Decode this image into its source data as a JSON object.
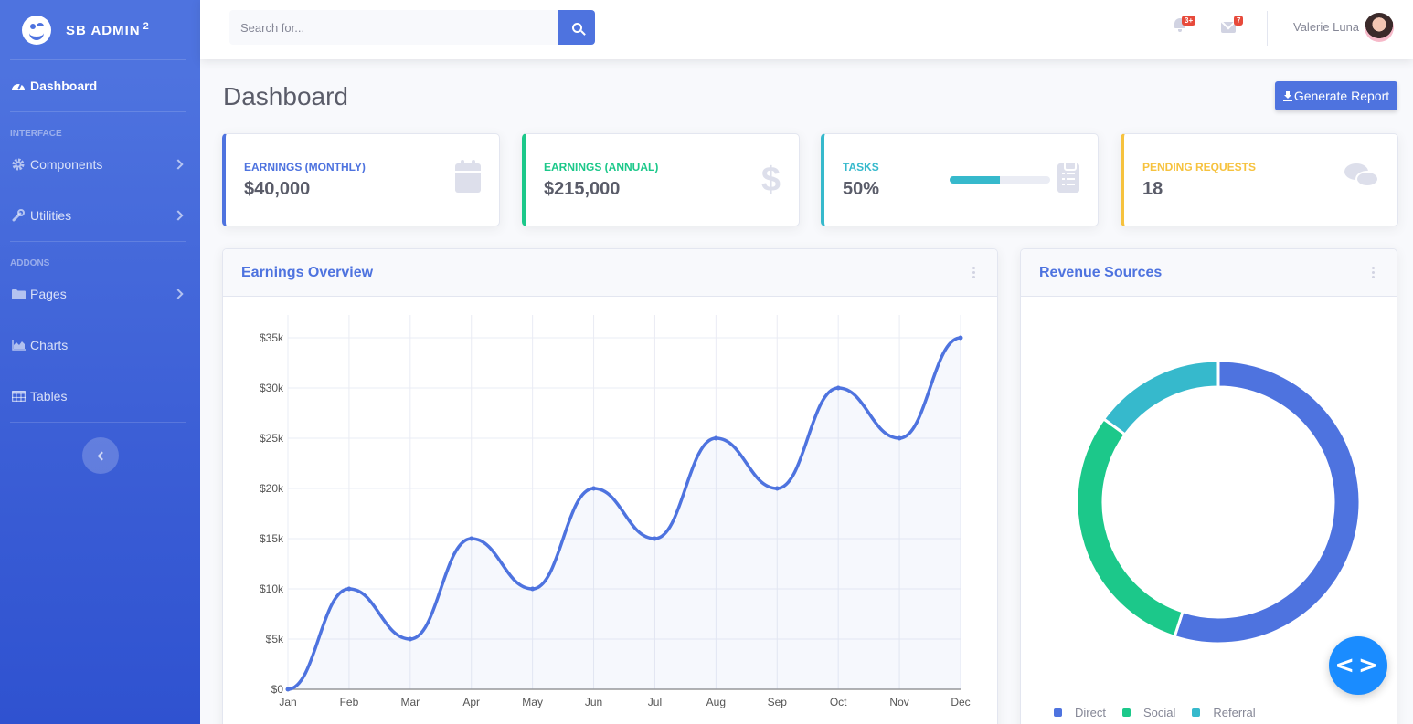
{
  "brand": {
    "name": "SB ADMIN",
    "superscript": "2"
  },
  "sidebar": {
    "dashboard": "Dashboard",
    "headings": [
      "Interface",
      "Addons"
    ],
    "items": [
      {
        "label": "Components",
        "icon": "cog-icon"
      },
      {
        "label": "Utilities",
        "icon": "wrench-icon"
      },
      {
        "label": "Pages",
        "icon": "folder-icon"
      },
      {
        "label": "Charts",
        "icon": "area-chart-icon"
      },
      {
        "label": "Tables",
        "icon": "table-icon"
      }
    ]
  },
  "topbar": {
    "search_placeholder": "Search for...",
    "alerts_badge": "3+",
    "messages_badge": "7",
    "user_name": "Valerie Luna"
  },
  "page": {
    "title": "Dashboard",
    "generate_report": "Generate Report"
  },
  "stats": [
    {
      "label": "Earnings (Monthly)",
      "value": "$40,000",
      "color": "#4e73df",
      "icon": "calendar-icon"
    },
    {
      "label": "Earnings (Annual)",
      "value": "$215,000",
      "color": "#1cc88a",
      "icon": "dollar-icon"
    },
    {
      "label": "Tasks",
      "value": "50%",
      "progress": 0.5,
      "color": "#36b9cc",
      "icon": "clipboard-icon"
    },
    {
      "label": "Pending Requests",
      "value": "18",
      "color": "#f6c23e",
      "icon": "comments-icon"
    }
  ],
  "earnings_card": {
    "title": "Earnings Overview"
  },
  "revenue_card": {
    "title": "Revenue Sources"
  },
  "chart_data": [
    {
      "type": "area",
      "title": "Earnings Overview",
      "categories": [
        "Jan",
        "Feb",
        "Mar",
        "Apr",
        "May",
        "Jun",
        "Jul",
        "Aug",
        "Sep",
        "Oct",
        "Nov",
        "Dec"
      ],
      "values": [
        0,
        10000,
        5000,
        15000,
        10000,
        20000,
        15000,
        25000,
        20000,
        30000,
        25000,
        35000
      ],
      "ylim": [
        0,
        35000
      ],
      "yticks": [
        "$0",
        "$5k",
        "$10k",
        "$15k",
        "$20k",
        "$25k",
        "$30k",
        "$35k"
      ],
      "color": "#4e73df",
      "grid": true
    },
    {
      "type": "pie",
      "title": "Revenue Sources",
      "series": [
        {
          "name": "Direct",
          "value": 55,
          "color": "#4e73df"
        },
        {
          "name": "Social",
          "value": 30,
          "color": "#1cc88a"
        },
        {
          "name": "Referral",
          "value": 15,
          "color": "#36b9cc"
        }
      ],
      "legend": "bottom"
    }
  ]
}
